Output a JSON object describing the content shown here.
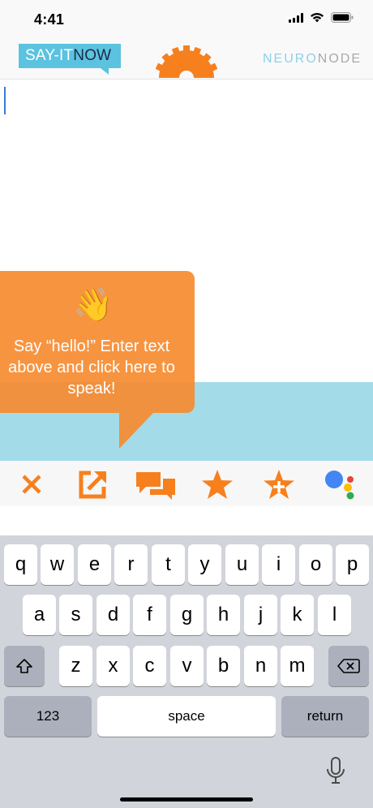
{
  "status_bar": {
    "time": "4:41"
  },
  "header": {
    "logo_left_part1": "SAY-IT",
    "logo_left_part2": "NOW",
    "logo_right_part1": "NEURO",
    "logo_right_part2": "NODE",
    "accent_color": "#f7801e",
    "brand_blue": "#5bc2e0"
  },
  "editor": {
    "value": ""
  },
  "tooltip": {
    "emoji": "👋",
    "text": "Say “hello!” Enter text above and click here to speak!",
    "color": "#f68b30"
  },
  "toolbar": {
    "icons": [
      "close-icon",
      "share-icon",
      "chat-icon",
      "star-icon",
      "add-favorite-icon",
      "google-assistant-icon"
    ]
  },
  "keyboard": {
    "row1": [
      "q",
      "w",
      "e",
      "r",
      "t",
      "y",
      "u",
      "i",
      "o",
      "p"
    ],
    "row2": [
      "a",
      "s",
      "d",
      "f",
      "g",
      "h",
      "j",
      "k",
      "l"
    ],
    "row3": [
      "z",
      "x",
      "c",
      "v",
      "b",
      "n",
      "m"
    ],
    "numbers_label": "123",
    "space_label": "space",
    "return_label": "return"
  }
}
